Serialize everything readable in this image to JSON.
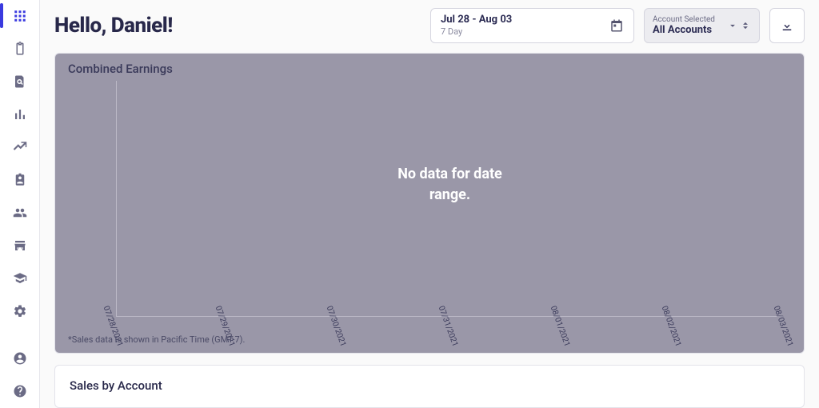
{
  "greeting": "Hello, Daniel!",
  "date_picker": {
    "range": "Jul 28 - Aug 03",
    "sub": "7 Day"
  },
  "account_select": {
    "label": "Account Selected",
    "value": "All Accounts"
  },
  "card1": {
    "title": "Combined Earnings",
    "no_data": "No data for date range.",
    "footnote": "*Sales data is shown in Pacific Time (GMT-7).",
    "x_ticks": [
      "07/28/2021",
      "07/29/2021",
      "07/30/2021",
      "07/31/2021",
      "08/01/2021",
      "08/02/2021",
      "08/03/2021"
    ]
  },
  "card2": {
    "title": "Sales by Account"
  },
  "chart_data": {
    "type": "line",
    "title": "Combined Earnings",
    "categories": [
      "07/28/2021",
      "07/29/2021",
      "07/30/2021",
      "07/31/2021",
      "08/01/2021",
      "08/02/2021",
      "08/03/2021"
    ],
    "series": [],
    "note": "No data for date range."
  }
}
